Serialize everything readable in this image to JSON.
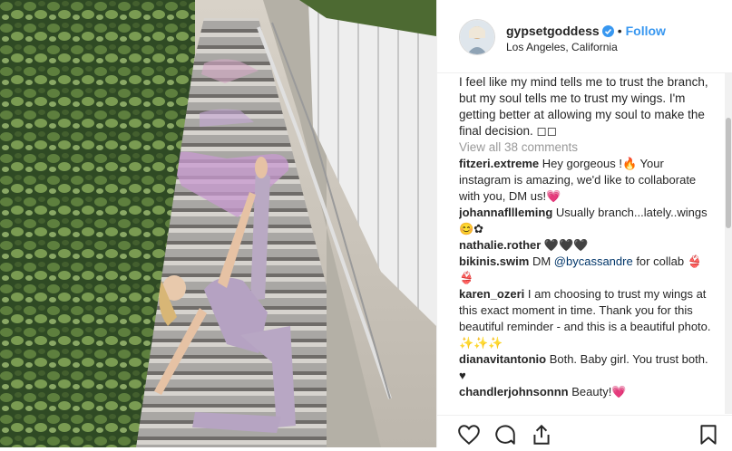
{
  "header": {
    "username": "gypsetgoddess",
    "separator": "•",
    "follow_label": "Follow",
    "location": "Los Angeles, California"
  },
  "caption": {
    "text": "I feel like my mind tells me to trust the branch, but my soul tells me to trust my wings. I'm getting better at allowing my soul to make the final decision. ◻◻"
  },
  "view_all": "View all 38 comments",
  "comments": [
    {
      "user": "fitzeri.extreme",
      "text": "Hey gorgeous !🔥 Your instagram is amazing, we'd like to collaborate with you, DM us!💗"
    },
    {
      "user": "johannafllleming",
      "text": "Usually branch...lately..wings 😊✿"
    },
    {
      "user": "nathalie.rother",
      "text": "🖤🖤🖤"
    },
    {
      "user": "bikinis.swim",
      "text_before": "DM",
      "mention": "@bycassandre",
      "text_after": "for collab 👙👙"
    },
    {
      "user": "karen_ozeri",
      "text": "I am choosing to trust my wings at this exact moment in time. Thank you for this beautiful reminder - and this is a beautiful photo. ✨✨✨"
    },
    {
      "user": "dianavitantonio",
      "text": "Both. Baby girl. You trust both. ♥"
    },
    {
      "user": "chandlerjohnsonnn",
      "text": "Beauty!💗"
    }
  ],
  "colors": {
    "link": "#3897f0",
    "muted": "#999999",
    "text": "#262626",
    "verified": "#3897f0"
  },
  "icons": {
    "like": "heart-icon",
    "comment": "comment-icon",
    "share": "share-icon",
    "save": "bookmark-icon"
  }
}
